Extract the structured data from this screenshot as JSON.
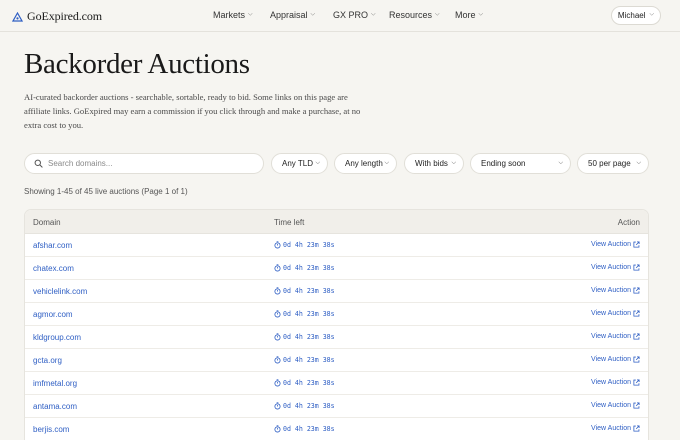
{
  "brand": {
    "name": "GoExpired.com",
    "accent": "#2f5fc4"
  },
  "nav": {
    "items": [
      {
        "label": "Markets"
      },
      {
        "label": "Appraisal"
      },
      {
        "label": "GX PRO"
      },
      {
        "label": "Resources"
      },
      {
        "label": "More"
      }
    ],
    "user": "Michael"
  },
  "page": {
    "title": "Backorder Auctions",
    "intro": "AI-curated backorder auctions - searchable, sortable, ready to bid. Some links on this page are affiliate links. GoExpired may earn a commission if you click through and make a purchase, at no extra cost to you."
  },
  "filters": {
    "search_placeholder": "Search domains...",
    "search_value": "",
    "tld": "Any TLD",
    "length": "Any length",
    "bids": "With bids",
    "sort": "Ending soon",
    "per_page": "50 per page"
  },
  "summary": "Showing 1-45 of 45 live auctions (Page 1 of 1)",
  "table": {
    "columns": {
      "domain": "Domain",
      "time": "Time left",
      "action": "Action"
    },
    "rows": [
      {
        "domain": "afshar.com",
        "time": "0d 4h 23m 38s",
        "action": "View Auction"
      },
      {
        "domain": "chatex.com",
        "time": "0d 4h 23m 38s",
        "action": "View Auction"
      },
      {
        "domain": "vehiclelink.com",
        "time": "0d 4h 23m 38s",
        "action": "View Auction"
      },
      {
        "domain": "agmor.com",
        "time": "0d 4h 23m 38s",
        "action": "View Auction"
      },
      {
        "domain": "kldgroup.com",
        "time": "0d 4h 23m 38s",
        "action": "View Auction"
      },
      {
        "domain": "gcta.org",
        "time": "0d 4h 23m 38s",
        "action": "View Auction"
      },
      {
        "domain": "imfmetal.org",
        "time": "0d 4h 23m 38s",
        "action": "View Auction"
      },
      {
        "domain": "antama.com",
        "time": "0d 4h 23m 38s",
        "action": "View Auction"
      },
      {
        "domain": "berjis.com",
        "time": "0d 4h 23m 38s",
        "action": "View Auction"
      }
    ]
  }
}
